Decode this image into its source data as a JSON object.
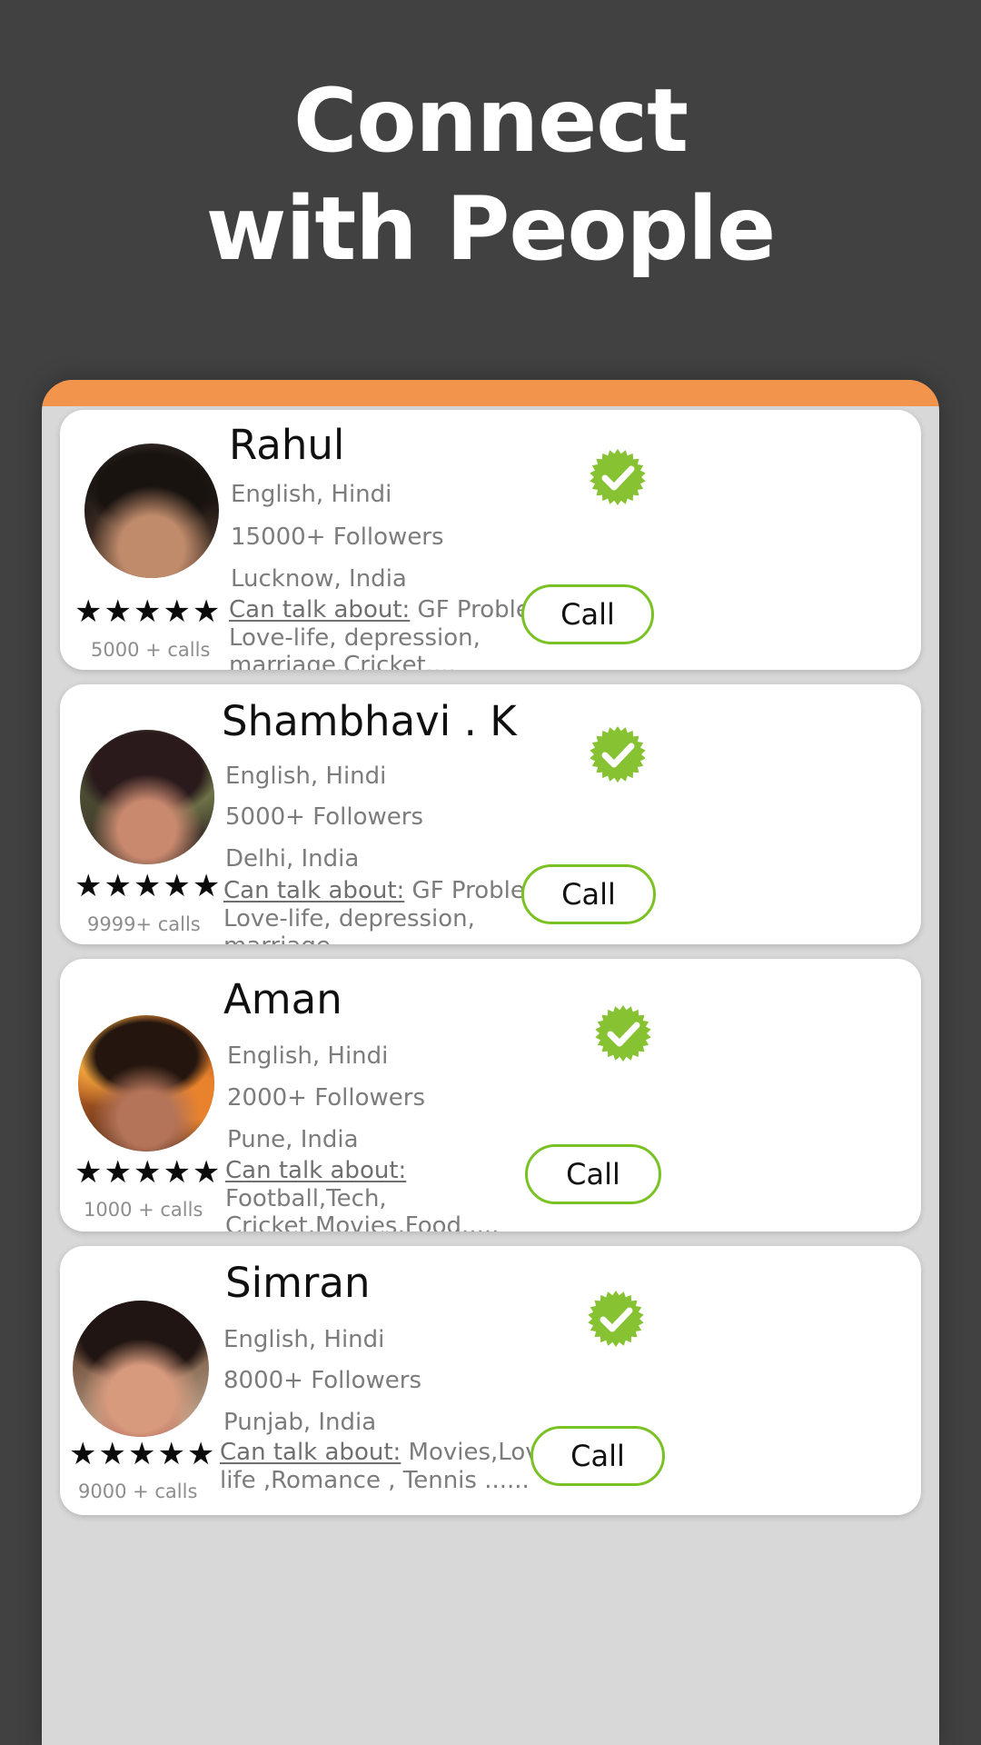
{
  "headline": {
    "line1": "Connect",
    "line2": "with People"
  },
  "theme": {
    "background": "#414141",
    "accent_orange": "#f2944c",
    "accent_green": "#7ac224",
    "verified_green": "#86c232",
    "card_bg": "#ffffff",
    "phone_bg": "#d8d8d8"
  },
  "labels": {
    "call_button": "Call",
    "talk_label": "Can talk about:",
    "stars": "★★★★★",
    "verified_icon": "verified-check-icon"
  },
  "cards": [
    {
      "name": "Rahul",
      "languages": "English, Hindi",
      "followers": "15000+  Followers",
      "location": "Lucknow, India",
      "talk_about": " GF Problems, Love-life, depression, marriage,Cricket....",
      "calls": "5000 + calls",
      "stars": "★★★★★",
      "call_label": "Call",
      "verified": true
    },
    {
      "name": "Shambhavi . K",
      "languages": "English, Hindi",
      "followers": "5000+  Followers",
      "location": " Delhi, India",
      "talk_about": " GF Problems, Love-life, depression, marriage,",
      "calls": "9999+ calls",
      "stars": "★★★★★",
      "call_label": "Call",
      "verified": true
    },
    {
      "name": "Aman",
      "languages": "English, Hindi",
      "followers": "2000+  Followers",
      "location": "Pune, India",
      "talk_about": " Football,Tech, Cricket,Movies,Food.....",
      "calls": "1000 + calls",
      "stars": "★★★★★",
      "call_label": "Call",
      "verified": true
    },
    {
      "name": "Simran",
      "languages": "English, Hindi",
      "followers": "8000+  Followers",
      "location": " Punjab, India",
      "talk_about": " Movies,Love life ,Romance , Tennis ......",
      "calls": "9000 + calls",
      "stars": "★★★★★",
      "call_label": "Call",
      "verified": true
    }
  ]
}
